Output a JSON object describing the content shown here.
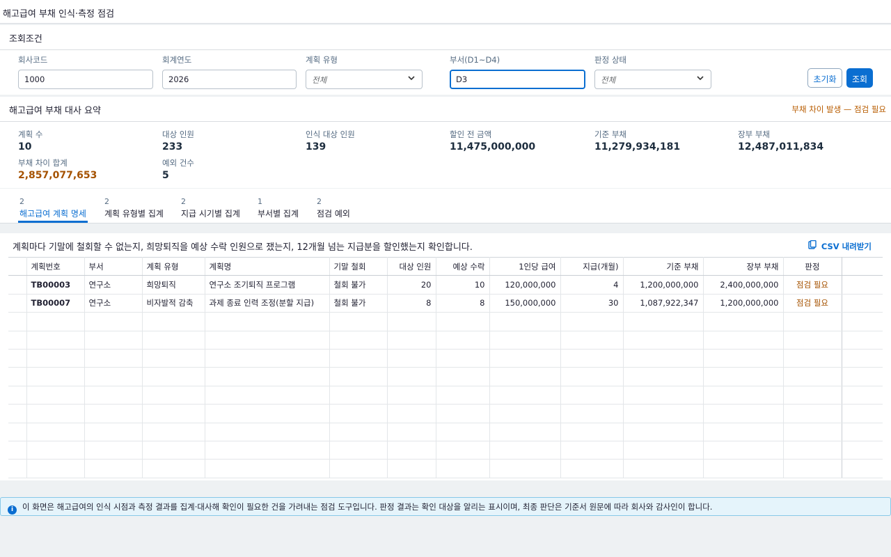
{
  "page": {
    "title": "해고급여 부채 인식·측정 점검"
  },
  "filter": {
    "title": "조회조건",
    "company_code": {
      "label": "회사코드",
      "value": "1000"
    },
    "fiscal_year": {
      "label": "회계연도",
      "value": "2026"
    },
    "plan_type": {
      "label": "계획 유형",
      "value": "전체"
    },
    "department": {
      "label": "부서(D1~D4)",
      "value": "D3"
    },
    "judgment": {
      "label": "판정 상태",
      "value": "전체"
    },
    "reset_label": "초기화",
    "search_label": "조회"
  },
  "summary": {
    "title": "해고급여 부채 대사 요약",
    "alert": "부채 차이 발생 — 점검 필요",
    "kpis": [
      {
        "label": "계획 수",
        "value": "10"
      },
      {
        "label": "대상 인원",
        "value": "233"
      },
      {
        "label": "인식 대상 인원",
        "value": "139"
      },
      {
        "label": "할인 전 금액",
        "value": "11,475,000,000"
      },
      {
        "label": "기준 부채",
        "value": "11,279,934,181"
      },
      {
        "label": "장부 부채",
        "value": "12,487,011,834"
      },
      {
        "label": "부채 차이 합계",
        "value": "2,857,077,653"
      },
      {
        "label": "예외 건수",
        "value": "5"
      }
    ],
    "warn_color": "#a55200"
  },
  "tabs": [
    {
      "count": "2",
      "label": "해고급여 계획 명세"
    },
    {
      "count": "2",
      "label": "계획 유형별 집계"
    },
    {
      "count": "2",
      "label": "지급 시기별 집계"
    },
    {
      "count": "1",
      "label": "부서별 집계"
    },
    {
      "count": "2",
      "label": "점검 예외"
    }
  ],
  "grid": {
    "description": "계획마다 기말에 철회할 수 없는지, 희망퇴직을 예상 수락 인원으로 쟀는지, 12개월 넘는 지급분을 할인했는지 확인합니다.",
    "csv_label": "CSV 내려받기",
    "columns": [
      "계획번호",
      "부서",
      "계획 유형",
      "계획명",
      "기말 철회",
      "대상 인원",
      "예상 수락",
      "1인당 급여",
      "지급(개월)",
      "기준 부채",
      "장부 부채",
      "판정"
    ],
    "rows": [
      [
        "TB00003",
        "연구소",
        "희망퇴직",
        "연구소 조기퇴직 프로그램",
        "철회 불가",
        "20",
        "10",
        "120,000,000",
        "4",
        "1,200,000,000",
        "2,400,000,000",
        "점검 필요"
      ],
      [
        "TB00007",
        "연구소",
        "비자발적 감축",
        "과제 종료 인력 조정(분할 지급)",
        "철회 불가",
        "8",
        "8",
        "150,000,000",
        "30",
        "1,087,922,347",
        "1,200,000,000",
        "점검 필요"
      ]
    ]
  },
  "info": {
    "text": "이 화면은 해고급여의 인식 시점과 측정 결과를 집계·대사해 확인이 필요한 건을 가려내는 점검 도구입니다. 판정 결과는 확인 대상을 알리는 표시이며, 최종 판단은 기준서 원문에 따라 회사와 감사인이 합니다."
  },
  "colors": {
    "accent": "#0a6ed1",
    "warning": "#a55200",
    "info_bg": "#e5f4fb"
  }
}
